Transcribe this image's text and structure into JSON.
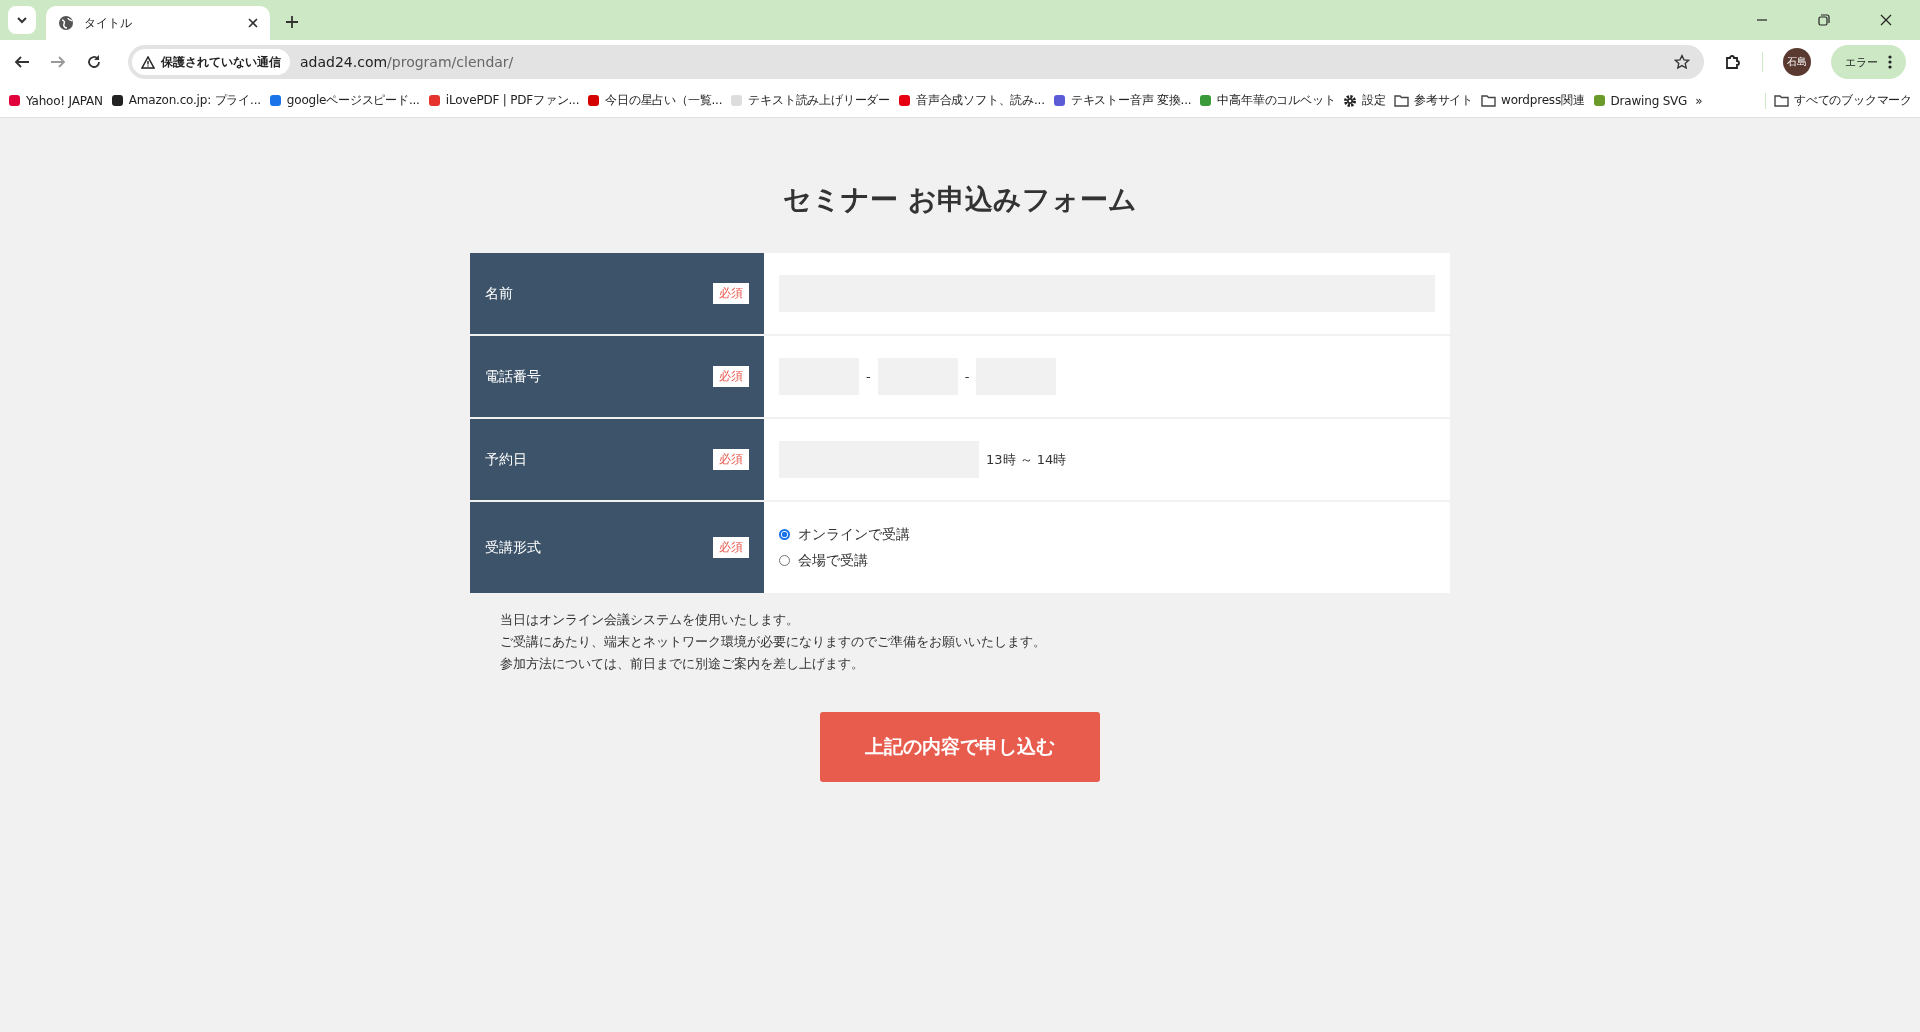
{
  "browser": {
    "tab_title": "タイトル",
    "security_label": "保護されていない通信",
    "url_host": "adad24.com",
    "url_path": "/program/clendar/",
    "profile": "石島",
    "error_button": "エラー",
    "bookmarks": [
      {
        "label": "Yahoo! JAPAN",
        "kind": "site"
      },
      {
        "label": "Amazon.co.jp: プライ...",
        "kind": "site"
      },
      {
        "label": "googleページスピード...",
        "kind": "site"
      },
      {
        "label": "iLovePDF | PDFファン...",
        "kind": "site"
      },
      {
        "label": "今日の星占い（一覧...",
        "kind": "site"
      },
      {
        "label": "テキスト読み上げリーダー",
        "kind": "site"
      },
      {
        "label": "音声合成ソフト、読み...",
        "kind": "site"
      },
      {
        "label": "テキストー音声 変換...",
        "kind": "site"
      },
      {
        "label": "中高年華のコルベット",
        "kind": "site"
      },
      {
        "label": "設定",
        "kind": "settings"
      },
      {
        "label": "参考サイト",
        "kind": "folder"
      },
      {
        "label": "wordpress関連",
        "kind": "folder"
      },
      {
        "label": "Drawing SVG",
        "kind": "site"
      }
    ],
    "overflow": "»",
    "all_bookmarks": "すべてのブックマーク"
  },
  "page": {
    "title": "セミナー お申込みフォーム",
    "rows": [
      {
        "kind": "text",
        "label": "名前",
        "required": "必須"
      },
      {
        "kind": "phone",
        "label": "電話番号",
        "required": "必須",
        "separators": [
          "-",
          "-"
        ]
      },
      {
        "kind": "date",
        "label": "予約日",
        "required": "必須",
        "suffix": "13時 ～ 14時"
      },
      {
        "kind": "radio",
        "label": "受講形式",
        "required": "必須",
        "options": [
          {
            "label": "オンラインで受講",
            "selected": true
          },
          {
            "label": "会場で受講",
            "selected": false
          }
        ]
      }
    ],
    "notes": [
      "当日はオンライン会議システムを使用いたします。",
      "ご受講にあたり、端末とネットワーク環境が必要になりますのでご準備をお願いいたします。",
      "参加方法については、前日までに別途ご案内を差し上げます。"
    ],
    "submit": "上記の内容で申し込む"
  }
}
